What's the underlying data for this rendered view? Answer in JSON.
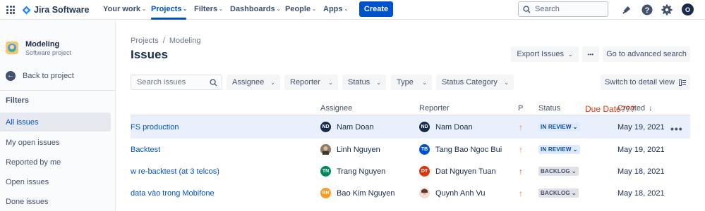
{
  "app": {
    "brand": "Jira Software",
    "brand_color": "#0052cc",
    "nav": [
      {
        "label": "Your work",
        "active": false
      },
      {
        "label": "Projects",
        "active": true
      },
      {
        "label": "Filters",
        "active": false
      },
      {
        "label": "Dashboards",
        "active": false
      },
      {
        "label": "People",
        "active": false
      },
      {
        "label": "Apps",
        "active": false
      }
    ],
    "create_label": "Create",
    "search_placeholder": "Search",
    "user_initial": "O"
  },
  "sidebar": {
    "project_name": "Modeling",
    "project_type": "Software project",
    "back_label": "Back to project",
    "filters_heading": "Filters",
    "items": [
      {
        "label": "All issues",
        "active": true
      },
      {
        "label": "My open issues",
        "active": false
      },
      {
        "label": "Reported by me",
        "active": false
      },
      {
        "label": "Open issues",
        "active": false
      },
      {
        "label": "Done issues",
        "active": false
      }
    ]
  },
  "main": {
    "breadcrumb": [
      "Projects",
      "/",
      "Modeling"
    ],
    "title": "Issues",
    "export_label": "Export Issues",
    "more_label": "•••",
    "advanced_search_label": "Go to advanced search",
    "search_placeholder": "Search issues",
    "filters": [
      "Assignee",
      "Reporter",
      "Status",
      "Type",
      "Status Category"
    ],
    "switch_view_label": "Switch to detail view"
  },
  "table": {
    "headers": {
      "assignee": "Assignee",
      "reporter": "Reporter",
      "priority": "P",
      "status": "Status",
      "created": "Created"
    },
    "annotation": "Due Date???",
    "rows": [
      {
        "summary": "FS production",
        "assignee": "Nam Doan",
        "assignee_initials": "ND",
        "assignee_color": "#172b4d",
        "reporter": "Nam Doan",
        "reporter_initials": "ND",
        "reporter_color": "#172b4d",
        "priority_color": "#ff7452",
        "status": "IN REVIEW",
        "status_bg": "#deebff",
        "status_fg": "#0747a6",
        "created": "May 19, 2021"
      },
      {
        "summary": "Backtest",
        "assignee": "Linh Nguyen",
        "assignee_initials": "",
        "assignee_color": "#7a6a5a",
        "reporter": "Tang Bao Ngoc Bui",
        "reporter_initials": "TB",
        "reporter_color": "#0052cc",
        "priority_color": "#ff7452",
        "status": "IN REVIEW",
        "status_bg": "#deebff",
        "status_fg": "#0747a6",
        "created": "May 19, 2021"
      },
      {
        "summary": "w re-backtest (at 3 telcos)",
        "assignee": "Trang Nguyen",
        "assignee_initials": "TN",
        "assignee_color": "#00875a",
        "reporter": "Dat Nguyen Tuan",
        "reporter_initials": "DT",
        "reporter_color": "#de350b",
        "priority_color": "#e5493a",
        "status": "BACKLOG",
        "status_bg": "#dfe1e6",
        "status_fg": "#42526e",
        "created": "May 18, 2021"
      },
      {
        "summary": "data vào trong Mobifone",
        "assignee": "Bao Kim Nguyen",
        "assignee_initials": "BN",
        "assignee_color": "#ff991f",
        "reporter": "Quynh Anh Vu",
        "reporter_initials": "",
        "reporter_color": "#f2c4b8",
        "priority_color": "#ff7452",
        "status": "BACKLOG",
        "status_bg": "#dfe1e6",
        "status_fg": "#42526e",
        "created": "May 18, 2021"
      }
    ]
  }
}
